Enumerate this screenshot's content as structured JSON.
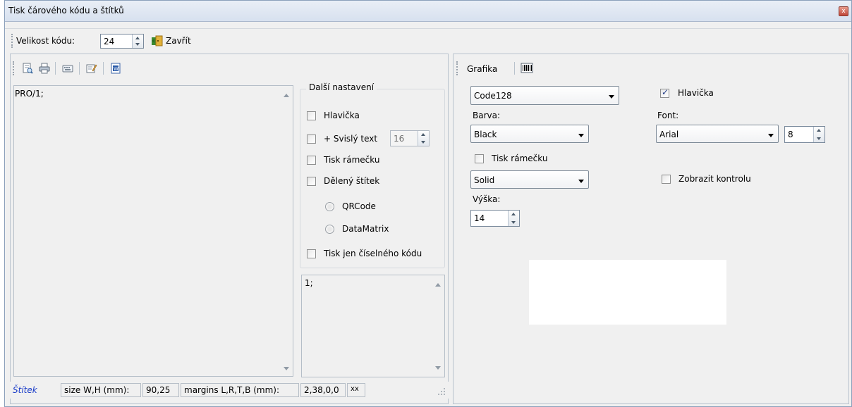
{
  "window": {
    "title": "Tisk čárového kódu a štítků",
    "close_glyph": "x"
  },
  "top_toolbar": {
    "size_label": "Velikost kódu:",
    "size_value": "24",
    "close_label": "Zavřít"
  },
  "left": {
    "main_text": "PRO/1;",
    "settings": {
      "group_title": "Další nastavení",
      "header_label": "Hlavička",
      "vertical_text_label": "+ Svislý text",
      "vertical_text_value": "16",
      "frame_label": "Tisk rámečku",
      "split_grid_label": "Dělený štítek",
      "qrcode_label": "QRCode",
      "datamatrix_label": "DataMatrix",
      "numeric_only_label": "Tisk jen číselného kódu"
    },
    "secondary_text": "1;",
    "status": {
      "label_link": "Štítek",
      "size_label": "size W,H (mm):",
      "size_value": "90,25",
      "margins_label": "margins L,R,T,B (mm):",
      "margins_value": "2,38,0,0",
      "extra": "xx"
    }
  },
  "right": {
    "tab_label": "Grafika",
    "code_type": "Code128",
    "color_label": "Barva:",
    "color_value": "Black",
    "frame_label": "Tisk rámečku",
    "line_style": "Solid",
    "height_label": "Výška:",
    "height_value": "14",
    "header_label": "Hlavička",
    "font_label": "Font:",
    "font_value": "Arial",
    "font_size": "8",
    "show_check_label": "Zobrazit kontrolu"
  }
}
